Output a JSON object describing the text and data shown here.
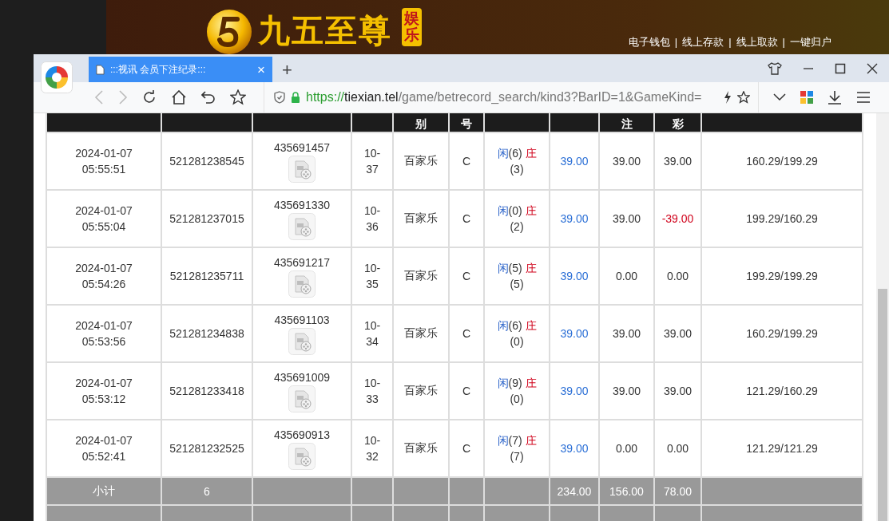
{
  "site_header": {
    "brand": "九五至尊",
    "badge": "娱乐",
    "links": [
      {
        "label": "电子钱包"
      },
      {
        "label": "线上存款",
        "separator": "|"
      },
      {
        "label": "线上取款",
        "separator": "|"
      },
      {
        "label": "一键归户",
        "separator": "|"
      }
    ]
  },
  "browser": {
    "tabs": [
      {
        "title": ":::视讯 会员下注纪录:::",
        "close": "×",
        "selected": true
      }
    ],
    "new_tab": "+",
    "address": {
      "scheme": "https://",
      "domain": "tiexian.tel",
      "path": "/game/betrecord_search/kind3?BarID=1&GameKind="
    }
  },
  "table": {
    "columns": [
      {},
      {},
      {},
      {},
      {
        "label": "别"
      },
      {
        "label": "号"
      },
      {},
      {},
      {
        "label": "注"
      },
      {
        "label": "彩"
      },
      {}
    ],
    "rows": [
      {
        "time": "2024-01-07 05:55:51",
        "bet_no": "521281238545",
        "round": "435691457",
        "shoe": "10-37",
        "game": "百家乐",
        "table": "C",
        "result": {
          "player_label": "闲",
          "player": "(6)",
          "banker_label": "庄",
          "banker": "(3)"
        },
        "valid_bet": "39.00",
        "bet": "39.00",
        "payout": {
          "text": "39.00",
          "color": "#333333"
        },
        "balance": "160.29/199.29"
      },
      {
        "time": "2024-01-07 05:55:04",
        "bet_no": "521281237015",
        "round": "435691330",
        "shoe": "10-36",
        "game": "百家乐",
        "table": "C",
        "result": {
          "player_label": "闲",
          "player": "(0)",
          "banker_label": "庄",
          "banker": "(2)"
        },
        "valid_bet": "39.00",
        "bet": "39.00",
        "payout": {
          "text": "-39.00",
          "color": "#d0021b"
        },
        "balance": "199.29/160.29"
      },
      {
        "time": "2024-01-07 05:54:26",
        "bet_no": "521281235711",
        "round": "435691217",
        "shoe": "10-35",
        "game": "百家乐",
        "table": "C",
        "result": {
          "player_label": "闲",
          "player": "(5)",
          "banker_label": "庄",
          "banker": "(5)"
        },
        "valid_bet": "39.00",
        "bet": "0.00",
        "payout": {
          "text": "0.00",
          "color": "#333333"
        },
        "balance": "199.29/199.29"
      },
      {
        "time": "2024-01-07 05:53:56",
        "bet_no": "521281234838",
        "round": "435691103",
        "shoe": "10-34",
        "game": "百家乐",
        "table": "C",
        "result": {
          "player_label": "闲",
          "player": "(6)",
          "banker_label": "庄",
          "banker": "(0)"
        },
        "valid_bet": "39.00",
        "bet": "39.00",
        "payout": {
          "text": "39.00",
          "color": "#333333"
        },
        "balance": "160.29/199.29"
      },
      {
        "time": "2024-01-07 05:53:12",
        "bet_no": "521281233418",
        "round": "435691009",
        "shoe": "10-33",
        "game": "百家乐",
        "table": "C",
        "result": {
          "player_label": "闲",
          "player": "(9)",
          "banker_label": "庄",
          "banker": "(0)"
        },
        "valid_bet": "39.00",
        "bet": "39.00",
        "payout": {
          "text": "39.00",
          "color": "#333333"
        },
        "balance": "121.29/160.29"
      },
      {
        "time": "2024-01-07 05:52:41",
        "bet_no": "521281232525",
        "round": "435690913",
        "shoe": "10-32",
        "game": "百家乐",
        "table": "C",
        "result": {
          "player_label": "闲",
          "player": "(7)",
          "banker_label": "庄",
          "banker": "(7)"
        },
        "valid_bet": "39.00",
        "bet": "0.00",
        "payout": {
          "text": "0.00",
          "color": "#333333"
        },
        "balance": "121.29/121.29"
      }
    ],
    "subtotal": {
      "label": "小计",
      "count": "6",
      "valid_bet": "234.00",
      "bet": "156.00",
      "payout": "78.00"
    }
  }
}
